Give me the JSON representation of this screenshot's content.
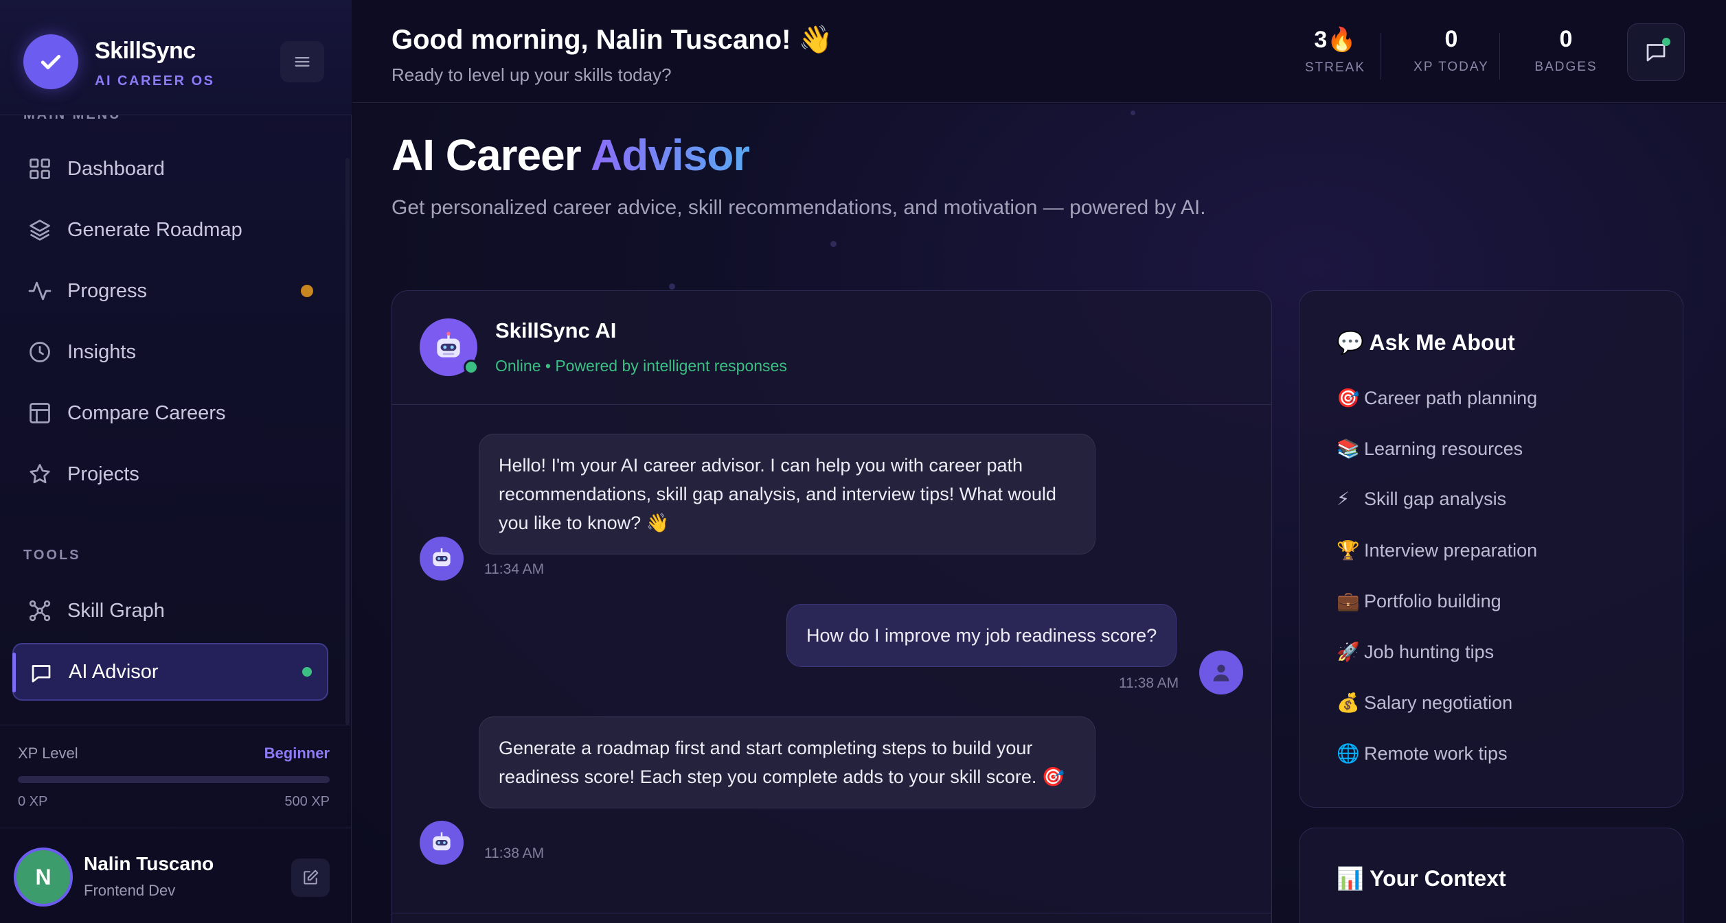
{
  "brand": {
    "name": "SkillSync",
    "tagline": "AI CAREER OS"
  },
  "sidebar": {
    "section_main": "MAIN MENU",
    "section_tools": "TOOLS",
    "items": [
      {
        "label": "Dashboard",
        "icon": "grid-icon"
      },
      {
        "label": "Generate Roadmap",
        "icon": "layers-icon"
      },
      {
        "label": "Progress",
        "icon": "activity-icon",
        "dot_color": "#c8861f"
      },
      {
        "label": "Insights",
        "icon": "clock-icon"
      },
      {
        "label": "Compare Careers",
        "icon": "table-icon"
      },
      {
        "label": "Projects",
        "icon": "star-icon"
      }
    ],
    "tools": [
      {
        "label": "Skill Graph",
        "icon": "graph-icon"
      },
      {
        "label": "AI Advisor",
        "icon": "chat-icon",
        "active": true,
        "dot_color": "#3bbf82"
      }
    ]
  },
  "xp": {
    "label": "XP Level",
    "level": "Beginner",
    "min": "0 XP",
    "max": "500 XP",
    "progress": 0
  },
  "user": {
    "initial": "N",
    "name": "Nalin Tuscano",
    "role": "Frontend Dev"
  },
  "header": {
    "greeting": "Good morning, Nalin Tuscano! 👋",
    "subtitle": "Ready to level up your skills today?",
    "stats": [
      {
        "value": "3🔥",
        "caption": "STREAK"
      },
      {
        "value": "0",
        "caption": "XP TODAY"
      },
      {
        "value": "0",
        "caption": "BADGES"
      }
    ]
  },
  "page": {
    "title_plain": "AI Career ",
    "title_accent": "Advisor",
    "description": "Get personalized career advice, skill recommendations, and motivation — powered by AI."
  },
  "chat": {
    "bot_name": "SkillSync AI",
    "bot_status": "Online • Powered by intelligent responses",
    "messages": [
      {
        "from": "bot",
        "text": "Hello! I'm your AI career advisor. I can help you with career path recommendations, skill gap analysis, and interview tips! What would you like to know? 👋",
        "time": "11:34 AM"
      },
      {
        "from": "user",
        "text": "How do I improve my job readiness score?",
        "time": "11:38 AM"
      },
      {
        "from": "bot",
        "text": "Generate a roadmap first and start completing steps to build your readiness score! Each step you complete adds to your skill score. 🎯",
        "time": "11:38 AM"
      }
    ]
  },
  "ask": {
    "title": "💬 Ask Me About",
    "items": [
      {
        "emoji": "🎯",
        "label": "Career path planning"
      },
      {
        "emoji": "📚",
        "label": "Learning resources"
      },
      {
        "emoji": "⚡",
        "label": "Skill gap analysis"
      },
      {
        "emoji": "🏆",
        "label": "Interview preparation"
      },
      {
        "emoji": "💼",
        "label": "Portfolio building"
      },
      {
        "emoji": "🚀",
        "label": "Job hunting tips"
      },
      {
        "emoji": "💰",
        "label": "Salary negotiation"
      },
      {
        "emoji": "🌐",
        "label": "Remote work tips"
      }
    ]
  },
  "context": {
    "title": "📊 Your Context"
  },
  "colors": {
    "accent": "#7c6cf7",
    "online": "#3bbf82",
    "warn": "#c8861f"
  }
}
